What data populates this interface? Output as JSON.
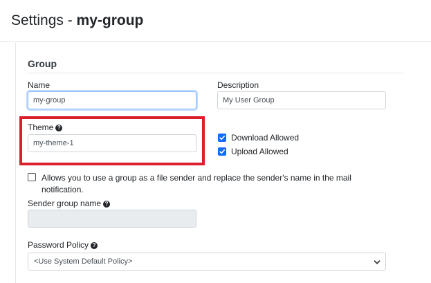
{
  "header": {
    "title_prefix": "Settings - ",
    "title_name": "my-group"
  },
  "group_section": {
    "heading": "Group",
    "name": {
      "label": "Name",
      "value": "my-group"
    },
    "description": {
      "label": "Description",
      "value": "My User Group"
    },
    "theme": {
      "label": "Theme",
      "value": "my-theme-1",
      "help_icon": "question-circle-icon"
    },
    "download_allowed": {
      "label": "Download Allowed",
      "checked": true
    },
    "upload_allowed": {
      "label": "Upload Allowed",
      "checked": true
    },
    "file_sender": {
      "label_line1": "Allows you to use a group as a file sender and replace the sender's name in the mail",
      "label_line2": "notification.",
      "checked": false
    },
    "sender_group_name": {
      "label": "Sender group name",
      "value": "",
      "disabled": true,
      "help_icon": "question-circle-icon"
    },
    "password_policy": {
      "label": "Password Policy",
      "selected": "<Use System Default Policy>",
      "help_icon": "question-circle-icon"
    }
  },
  "colors": {
    "highlight": "#d9202c",
    "checkbox_checked": "#0d6efd",
    "focus_border": "#86b7fe"
  }
}
